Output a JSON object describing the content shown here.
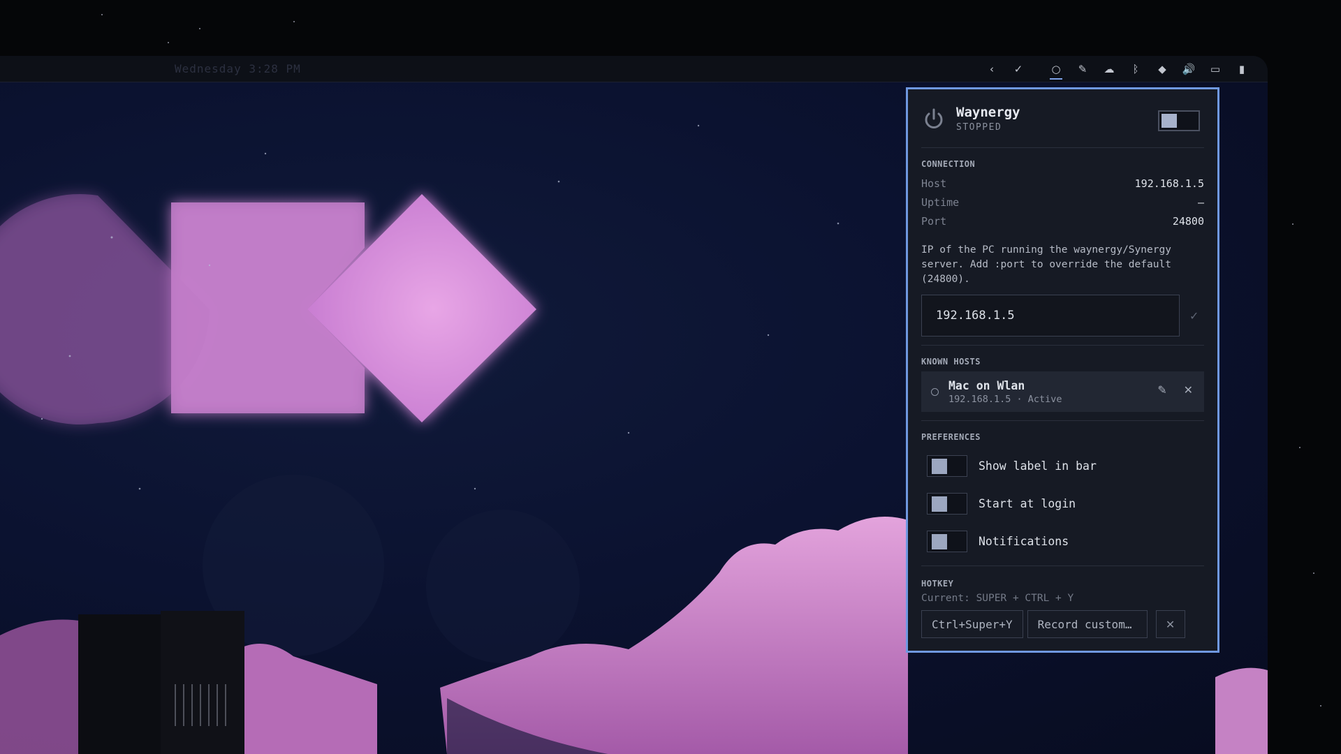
{
  "topbar": {
    "clock": "Wednesday 3:28 PM",
    "tray": [
      {
        "name": "chevron-left-icon",
        "glyph": "‹"
      },
      {
        "name": "check-icon",
        "glyph": "✓"
      },
      {
        "name": "waynergy-circle-icon",
        "glyph": "○"
      },
      {
        "name": "pencil-icon",
        "glyph": "✎"
      },
      {
        "name": "cloud-icon",
        "glyph": "☁"
      },
      {
        "name": "bluetooth-icon",
        "glyph": "ᛒ"
      },
      {
        "name": "wifi-icon",
        "glyph": "◆"
      },
      {
        "name": "volume-icon",
        "glyph": "🔊"
      },
      {
        "name": "monitor-icon",
        "glyph": "▭"
      },
      {
        "name": "battery-icon",
        "glyph": "▮"
      }
    ]
  },
  "panel": {
    "title": "Waynergy",
    "status": "STOPPED",
    "master_enabled": false,
    "connection": {
      "section_title": "CONNECTION",
      "host_label": "Host",
      "host_value": "192.168.1.5",
      "uptime_label": "Uptime",
      "uptime_value": "—",
      "port_label": "Port",
      "port_value": "24800",
      "hint": "IP of the PC running the waynergy/Synergy server. Add :port to override the default (24800).",
      "input_value": "192.168.1.5"
    },
    "known_hosts": {
      "section_title": "KNOWN HOSTS",
      "items": [
        {
          "name": "Mac on Wlan",
          "sub": "192.168.1.5 · Active"
        }
      ]
    },
    "preferences": {
      "section_title": "PREFERENCES",
      "items": [
        {
          "label": "Show label in bar",
          "enabled": false
        },
        {
          "label": "Start at login",
          "enabled": false
        },
        {
          "label": "Notifications",
          "enabled": false
        }
      ]
    },
    "hotkey": {
      "section_title": "HOTKEY",
      "current": "Current: SUPER + CTRL + Y",
      "preset_label": "Ctrl+Super+Y",
      "record_label": "Record custom…",
      "clear_glyph": "✕"
    }
  },
  "colors": {
    "accent": "#6f98e0",
    "wallpaper_shapes": "#d488d6",
    "clouds": "#c87ec8"
  }
}
